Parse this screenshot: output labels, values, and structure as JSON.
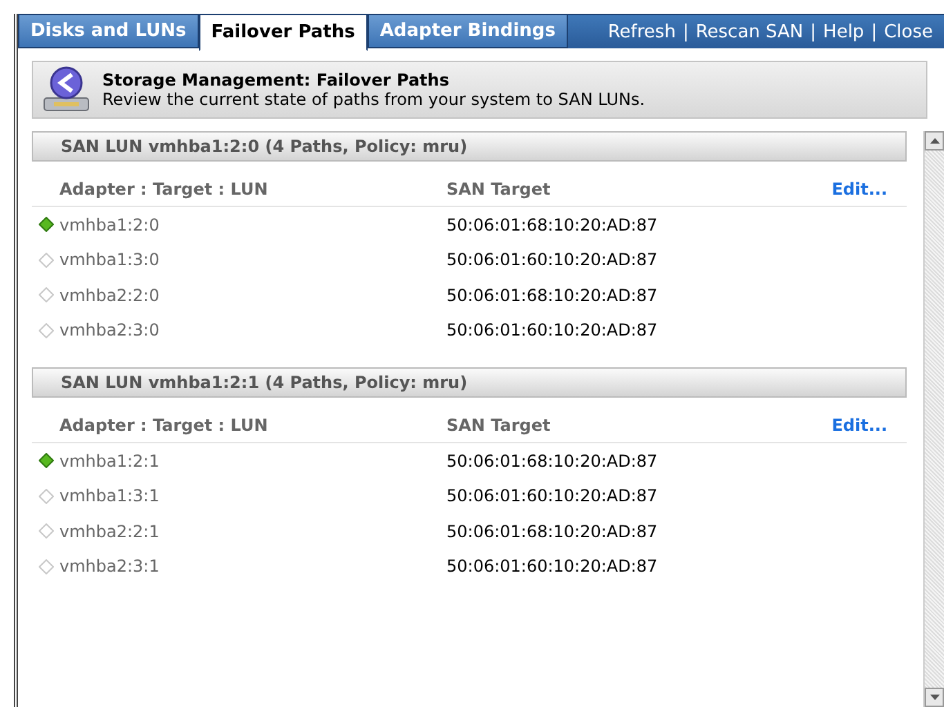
{
  "tabs": [
    {
      "label": "Disks and LUNs",
      "selected": false
    },
    {
      "label": "Failover Paths",
      "selected": true
    },
    {
      "label": "Adapter Bindings",
      "selected": false
    }
  ],
  "actions": [
    "Refresh",
    "Rescan SAN",
    "Help",
    "Close"
  ],
  "action_separator": "|",
  "header": {
    "title": "Storage Management: Failover Paths",
    "subtitle": "Review the current state of paths from your system to SAN LUNs."
  },
  "luns": [
    {
      "title": "SAN LUN vmhba1:2:0 (4 Paths, Policy: mru)",
      "columns": [
        "Adapter : Target : LUN",
        "SAN Target"
      ],
      "edit": "Edit...",
      "paths": [
        {
          "adapter": "vmhba1:2:0",
          "target": "50:06:01:68:10:20:AD:87",
          "active": true
        },
        {
          "adapter": "vmhba1:3:0",
          "target": "50:06:01:60:10:20:AD:87",
          "active": false
        },
        {
          "adapter": "vmhba2:2:0",
          "target": "50:06:01:68:10:20:AD:87",
          "active": false
        },
        {
          "adapter": "vmhba2:3:0",
          "target": "50:06:01:60:10:20:AD:87",
          "active": false
        }
      ]
    },
    {
      "title": "SAN LUN vmhba1:2:1 (4 Paths, Policy: mru)",
      "columns": [
        "Adapter : Target : LUN",
        "SAN Target"
      ],
      "edit": "Edit...",
      "paths": [
        {
          "adapter": "vmhba1:2:1",
          "target": "50:06:01:68:10:20:AD:87",
          "active": true
        },
        {
          "adapter": "vmhba1:3:1",
          "target": "50:06:01:60:10:20:AD:87",
          "active": false
        },
        {
          "adapter": "vmhba2:2:1",
          "target": "50:06:01:68:10:20:AD:87",
          "active": false
        },
        {
          "adapter": "vmhba2:3:1",
          "target": "50:06:01:60:10:20:AD:87",
          "active": false
        }
      ]
    }
  ]
}
